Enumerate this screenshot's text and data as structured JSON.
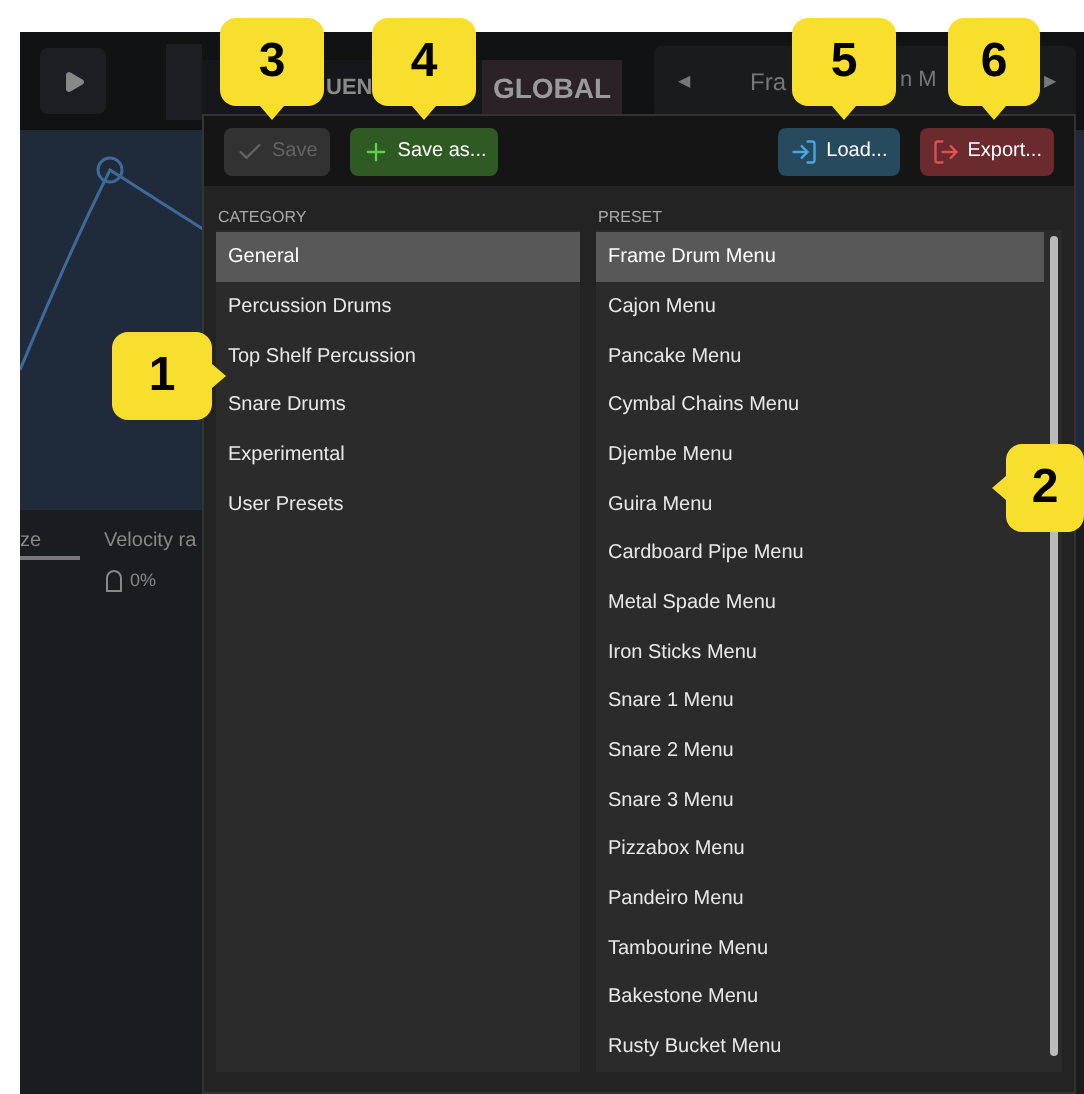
{
  "header": {
    "tabs": [
      {
        "label": "UEN",
        "selected": false
      },
      {
        "label": "GLOBAL",
        "selected": true
      }
    ],
    "preset_prev": "◀",
    "preset_name_start": "Fra",
    "preset_name_end": "n M",
    "preset_next": "▶"
  },
  "background": {
    "labels": [
      "ze",
      "Velocity ra"
    ],
    "reading": "0%"
  },
  "toolbar": {
    "buttons": [
      {
        "label": "Save",
        "kind": "save",
        "disabled": true
      },
      {
        "label": "Save as...",
        "kind": "save_as",
        "disabled": false
      },
      {
        "label": "Load...",
        "kind": "load",
        "disabled": false
      },
      {
        "label": "Export...",
        "kind": "export",
        "disabled": false
      }
    ]
  },
  "category": {
    "heading": "CATEGORY",
    "items": [
      {
        "label": "General",
        "selected": true
      },
      {
        "label": "Percussion Drums",
        "selected": false
      },
      {
        "label": "Top Shelf Percussion",
        "selected": false
      },
      {
        "label": "Snare Drums",
        "selected": false
      },
      {
        "label": "Experimental",
        "selected": false
      },
      {
        "label": "User Presets",
        "selected": false
      }
    ]
  },
  "preset": {
    "heading": "PRESET",
    "items": [
      {
        "label": "Frame Drum Menu",
        "selected": true
      },
      {
        "label": "Cajon Menu",
        "selected": false
      },
      {
        "label": "Pancake Menu",
        "selected": false
      },
      {
        "label": "Cymbal Chains Menu",
        "selected": false
      },
      {
        "label": "Djembe Menu",
        "selected": false
      },
      {
        "label": "Guira Menu",
        "selected": false
      },
      {
        "label": "Cardboard Pipe Menu",
        "selected": false
      },
      {
        "label": "Metal Spade Menu",
        "selected": false
      },
      {
        "label": "Iron Sticks Menu",
        "selected": false
      },
      {
        "label": "Snare 1 Menu",
        "selected": false
      },
      {
        "label": "Snare 2 Menu",
        "selected": false
      },
      {
        "label": "Snare 3 Menu",
        "selected": false
      },
      {
        "label": "Pizzabox Menu",
        "selected": false
      },
      {
        "label": "Pandeiro Menu",
        "selected": false
      },
      {
        "label": "Tambourine Menu",
        "selected": false
      },
      {
        "label": "Bakestone Menu",
        "selected": false
      },
      {
        "label": "Rusty Bucket Menu",
        "selected": false
      }
    ]
  },
  "callouts": [
    {
      "label": "3",
      "kind": "down"
    },
    {
      "label": "4",
      "kind": "down"
    },
    {
      "label": "5",
      "kind": "down"
    },
    {
      "label": "6",
      "kind": "down"
    },
    {
      "label": "1",
      "kind": "right"
    },
    {
      "label": "2",
      "kind": "left"
    }
  ]
}
